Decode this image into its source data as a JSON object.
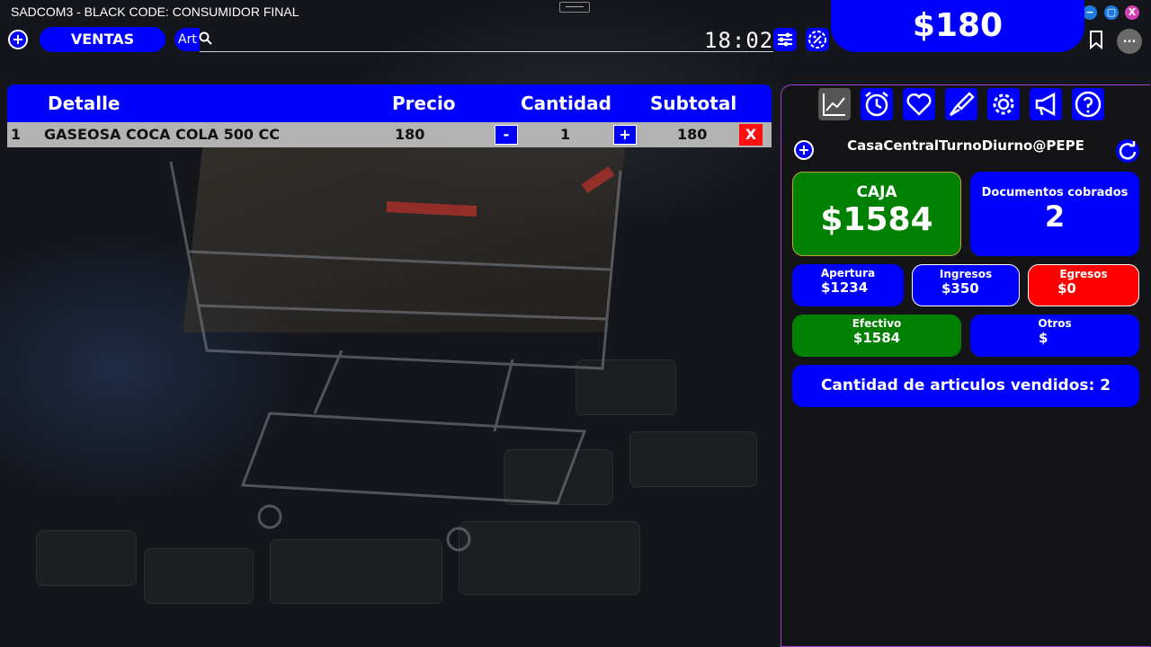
{
  "window": {
    "title": "SADCOM3 - BLACK CODE: CONSUMIDOR FINAL",
    "controls": {
      "minimize": "−",
      "maximize": "▢",
      "close": "X"
    }
  },
  "total": "$180",
  "toolbar": {
    "ventas_label": "VENTAS",
    "search_prefix": "Art",
    "clock": "18:02",
    "more_label": "..."
  },
  "sales_table": {
    "headers": {
      "detail": "Detalle",
      "price": "Precio",
      "quantity": "Cantidad",
      "subtotal": "Subtotal"
    },
    "rows": [
      {
        "index": "1",
        "detail": "GASEOSA COCA COLA 500 CC",
        "price": "180",
        "minus": "-",
        "quantity": "1",
        "plus": "+",
        "subtotal": "180",
        "delete": "X"
      }
    ]
  },
  "panel": {
    "icons": [
      "chart-icon",
      "alarm-icon",
      "heart-icon",
      "brush-icon",
      "gear-icon",
      "megaphone-icon",
      "help-icon"
    ],
    "session": "CasaCentralTurnoDiurno@PEPE",
    "caja": {
      "label": "CAJA",
      "value": "$1584"
    },
    "documentos": {
      "label": "Documentos cobrados",
      "value": "2"
    },
    "apertura": {
      "label": "Apertura",
      "value": "$1234"
    },
    "ingresos": {
      "label": "Ingresos",
      "value": "$350"
    },
    "egresos": {
      "label": "Egresos",
      "value": "$0"
    },
    "efectivo": {
      "label": "Efectivo",
      "value": "$1584"
    },
    "otros": {
      "label": "Otros",
      "value": "$"
    },
    "articulos": "Cantidad de articulos vendidos: 2"
  },
  "colors": {
    "primary": "#0000ff",
    "success": "#008000",
    "danger": "#ff0000",
    "panel_border": "#9b48c8"
  }
}
